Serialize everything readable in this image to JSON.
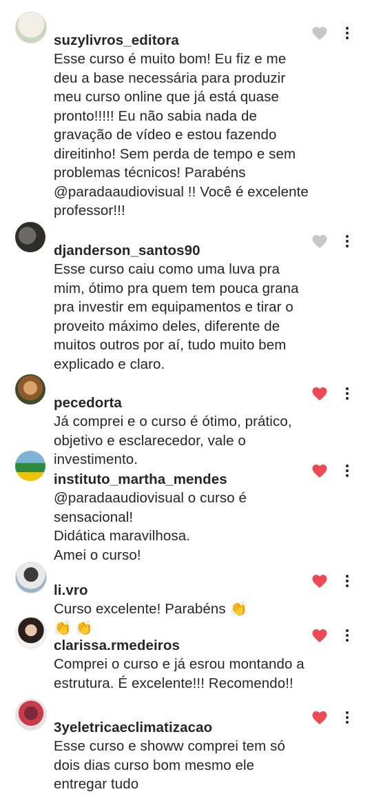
{
  "comments": [
    {
      "username": "suzylivros_editora",
      "text": "Esse curso é muito bom! Eu fiz e me deu a base necessária para produzir meu curso online que já está quase pronto!!!!! Eu não sabia nada de gravação de vídeo e estou fazendo direitinho! Sem perda de tempo e sem problemas técnicos! Parabéns @paradaaudiovisual !! Você é excelente professor!!!",
      "liked": false,
      "heart_color": "#c7c7c7"
    },
    {
      "username": "djanderson_santos90",
      "text": "Esse curso caiu como uma luva pra mim, ótimo pra quem tem pouca grana pra investir em equipamentos e tirar o proveito máximo deles, diferente de muitos outros por aí, tudo muito bem explicado e claro.",
      "liked": false,
      "heart_color": "#c7c7c7"
    },
    {
      "username": "pecedorta",
      "text": "Já comprei e o curso é ótimo, prático, objetivo e esclarecedor, vale o investimento.",
      "liked": true,
      "heart_color": "#ed4956"
    },
    {
      "username": "instituto_martha_mendes",
      "text": "@paradaaudiovisual o curso é sensacional!\nDidática maravilhosa.\nAmei o curso!",
      "liked": true,
      "heart_color": "#ed4956"
    },
    {
      "username": "li.vro",
      "text": "Curso excelente! Parabéns 👏\n👏 👏",
      "liked": true,
      "heart_color": "#ed4956"
    },
    {
      "username": "clarissa.rmedeiros",
      "text": "Comprei o curso e já esrou montando a estrutura. É excelente!!! Recomendo!!",
      "liked": true,
      "heart_color": "#ed4956"
    },
    {
      "username": "3yeletricaeclimatizacao",
      "text": "Esse curso e showw comprei tem só dois dias curso bom mesmo ele entregar tudo",
      "liked": true,
      "heart_color": "#ed4956"
    }
  ],
  "icons": {
    "like": "heart-icon",
    "options": "more-options-icon"
  }
}
